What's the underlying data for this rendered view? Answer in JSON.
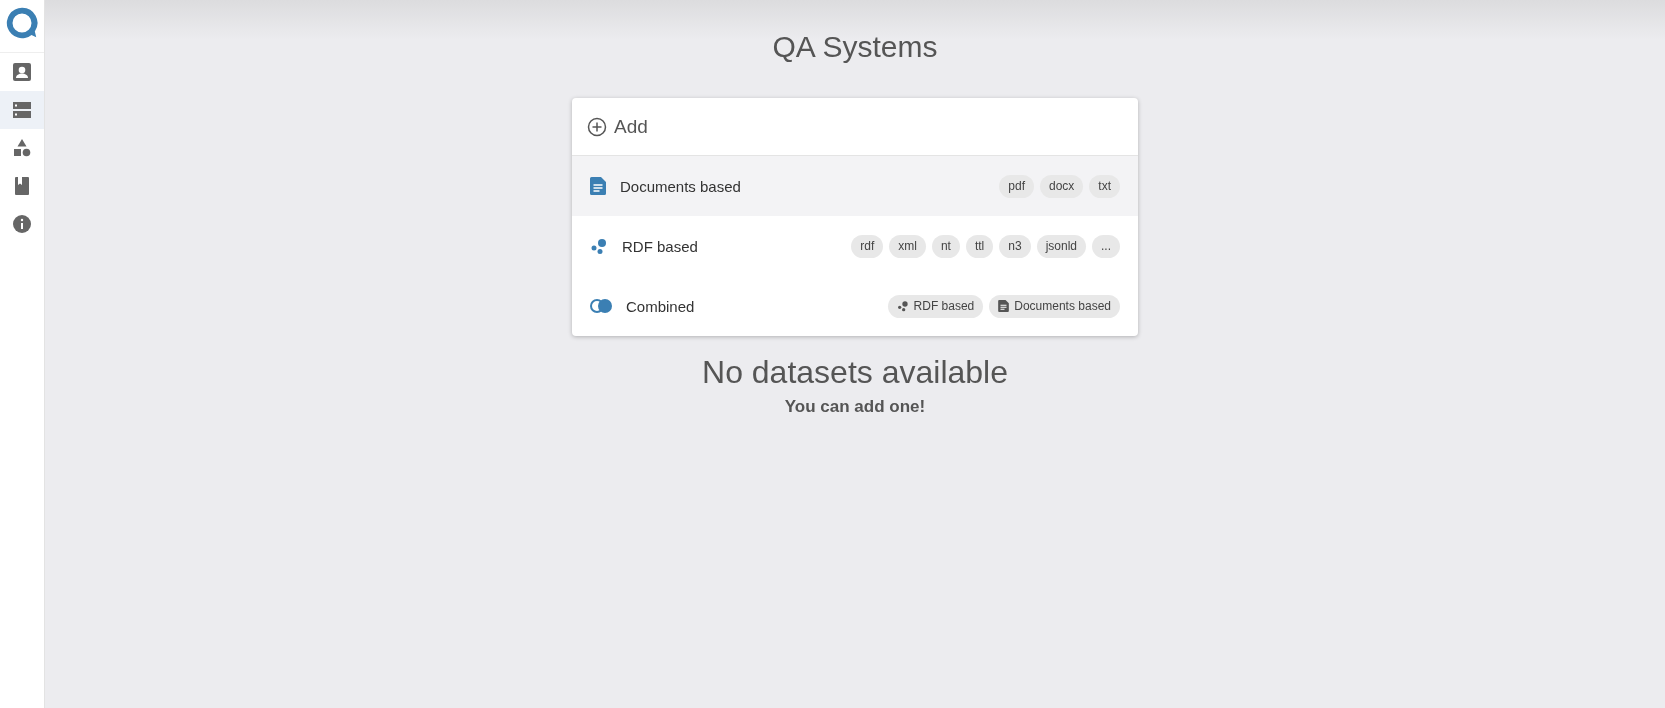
{
  "sidebar": {
    "items": [
      {
        "kind": "person",
        "selected": false
      },
      {
        "kind": "storage",
        "selected": true
      },
      {
        "kind": "shapes",
        "selected": false
      },
      {
        "kind": "book",
        "selected": false
      },
      {
        "kind": "info",
        "selected": false
      }
    ]
  },
  "title": "QA Systems",
  "add_menu": {
    "header": "Add",
    "options": [
      {
        "kind": "documents",
        "label": "Documents based",
        "highlighted": true,
        "tags": [
          {
            "label": "pdf"
          },
          {
            "label": "docx"
          },
          {
            "label": "txt"
          }
        ]
      },
      {
        "kind": "rdf",
        "label": "RDF based",
        "highlighted": false,
        "tags": [
          {
            "label": "rdf"
          },
          {
            "label": "xml"
          },
          {
            "label": "nt"
          },
          {
            "label": "ttl"
          },
          {
            "label": "n3"
          },
          {
            "label": "jsonld"
          },
          {
            "label": "..."
          }
        ]
      },
      {
        "kind": "combined",
        "label": "Combined",
        "highlighted": false,
        "tags": [
          {
            "label": "RDF based",
            "kind": "rdf"
          },
          {
            "label": "Documents based",
            "kind": "documents"
          }
        ]
      }
    ]
  },
  "empty_state": {
    "heading": "No datasets available",
    "hint": "You can add one!"
  }
}
